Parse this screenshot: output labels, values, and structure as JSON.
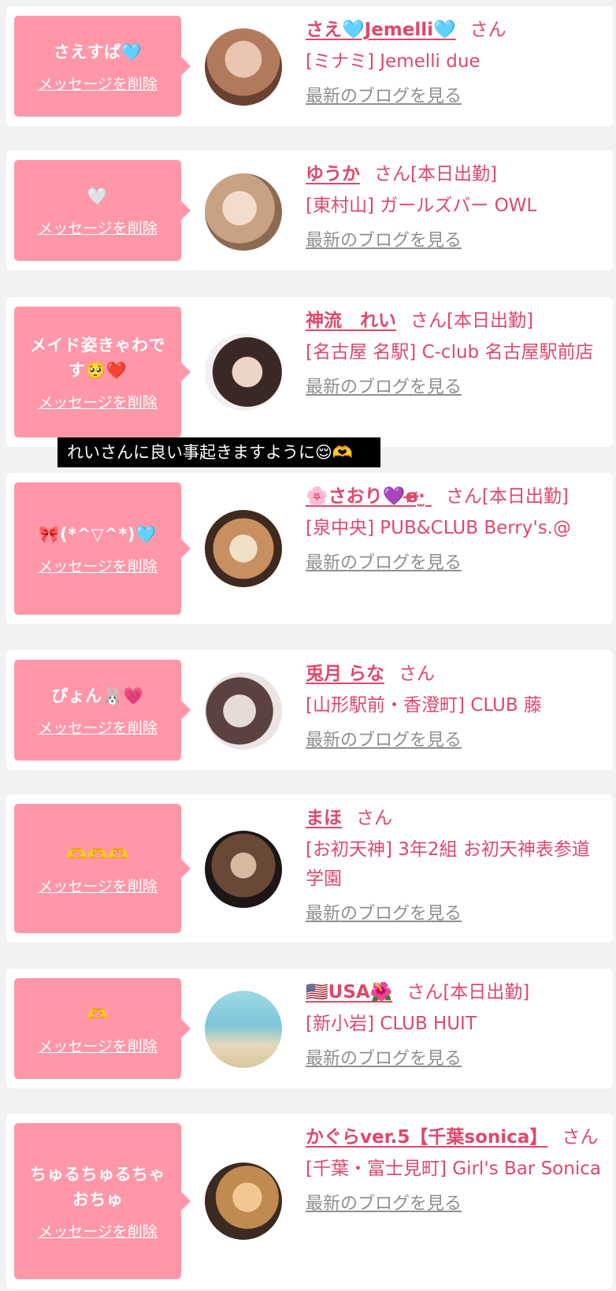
{
  "delete_label": "メッセージを削除",
  "blog_label": "最新のブログを見る",
  "san": "さん",
  "caption": "れいさんに良い事起きますように😌🫶",
  "cards": [
    {
      "message": "さえすぱ🩵",
      "name": "さえ🩵Jemelli🩵",
      "suffix": "さん",
      "shop": "[ミナミ] Jemelli due",
      "avatar_colors": [
        "#d9b8a6",
        "#8a5b48"
      ]
    },
    {
      "message": "🤍",
      "name": "ゆうか",
      "suffix": "さん[本日出勤]",
      "shop": "[東村山] ガールズバー OWL",
      "avatar_colors": [
        "#f0d6c0",
        "#c8a07c"
      ]
    },
    {
      "message": "メイド姿きゃわです🥺❤️",
      "name": "神流　れい",
      "suffix": "さん[本日出勤]",
      "shop": "[名古屋 名駅] C-club 名古屋駅前店",
      "avatar_colors": [
        "#e8d2c8",
        "#2a1e1c"
      ]
    },
    {
      "message": "🎀(*^▽^*)🩵",
      "name": "🌸さおり💜ɞ̴̶̷·̫ ",
      "suffix": "さん[本日出勤]",
      "shop": "[泉中央] PUB&CLUB Berry's.@",
      "avatar_colors": [
        "#c89060",
        "#4a3424"
      ]
    },
    {
      "message": "ぴょん🐰💗",
      "name": "兎月 らな",
      "suffix": "さん",
      "shop": "[山形駅前・香澄町] CLUB 藤",
      "avatar_colors": [
        "#e6dbd7",
        "#3a2a28"
      ]
    },
    {
      "message": "🫶🫶🫶",
      "name": "まほ",
      "suffix": "さん",
      "shop": "[お初天神] 3年2組 お初天神表参道学園",
      "avatar_colors": [
        "#b88060",
        "#1e1414"
      ]
    },
    {
      "message": "🫶",
      "name": "🇺🇸USA🌺",
      "suffix": "さん[本日出勤]",
      "shop": "[新小岩] CLUB HUIT",
      "avatar_colors": [
        "#7fc7d8",
        "#e8dcc0"
      ]
    },
    {
      "message": "ちゅるちゅるちゃおちゅ",
      "name": "かぐらver.5【千葉sonica】",
      "suffix": "さん",
      "shop": "[千葉・富士見町] Girl's Bar Sonica",
      "avatar_colors": [
        "#5a4030",
        "#e0b070"
      ]
    }
  ]
}
